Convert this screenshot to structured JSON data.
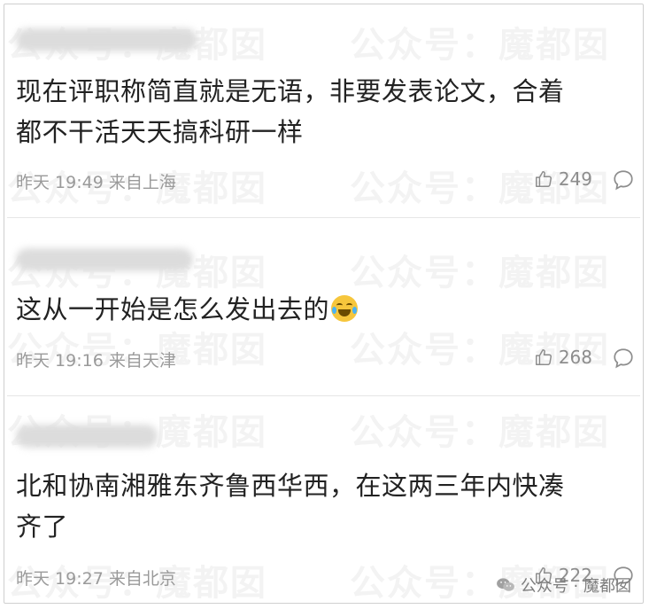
{
  "watermark_text": "公众号：魔都囡",
  "comments": [
    {
      "text_line1": "现在评职称简直就是无语，非要发表论文，合着",
      "text_line2": "都不干活天天搞科研一样",
      "time": "昨天 19:49",
      "location": "来自上海",
      "likes": "249"
    },
    {
      "text_line1": "这从一开始是怎么发出去的",
      "emoji": "laughing-with-tears",
      "time": "昨天 19:16",
      "location": "来自天津",
      "likes": "268"
    },
    {
      "text_line1": "北和协南湘雅东齐鲁西华西，在这两三年内快凑",
      "text_line2": "齐了",
      "time": "昨天 19:27",
      "location": "来自北京",
      "likes": "222"
    }
  ],
  "brand": {
    "label": "公众号 · 魔都囡",
    "icon": "wechat-icon"
  },
  "colors": {
    "text": "#222222",
    "meta": "#9a9a9a",
    "like": "#8d8d8d",
    "divider": "#e6e6e6"
  }
}
